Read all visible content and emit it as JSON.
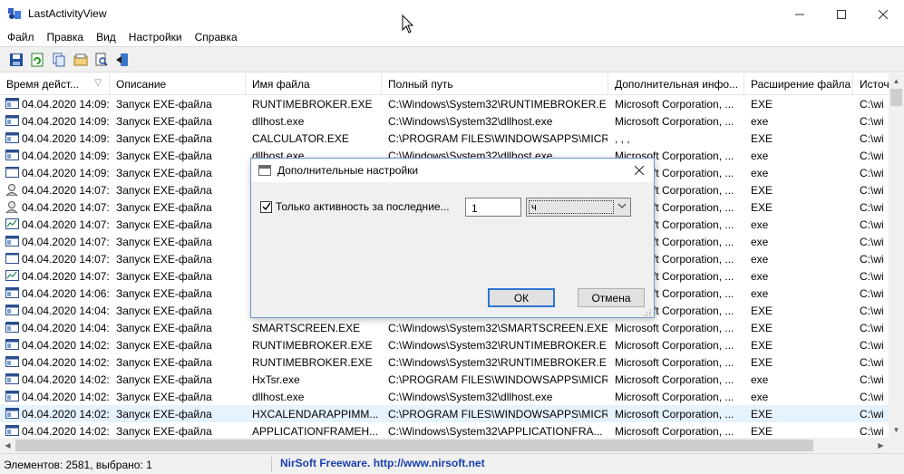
{
  "window": {
    "title": "LastActivityView"
  },
  "menu": [
    "Файл",
    "Правка",
    "Вид",
    "Настройки",
    "Справка"
  ],
  "toolbar": [
    "save-icon",
    "refresh-icon",
    "copy-icon",
    "properties-icon",
    "find-icon",
    "exit-icon"
  ],
  "columns": [
    {
      "label": "Время дейст...",
      "sorted": true
    },
    {
      "label": "Описание"
    },
    {
      "label": "Имя файла"
    },
    {
      "label": "Полный путь"
    },
    {
      "label": "Дополнительная инфо..."
    },
    {
      "label": "Расширение файла"
    },
    {
      "label": "Источ"
    }
  ],
  "rows": [
    {
      "icon": "window",
      "time": "04.04.2020 14:09:...",
      "desc": "Запуск EXE-файла",
      "file": "RUNTIMEBROKER.EXE",
      "path": "C:\\Windows\\System32\\RUNTIMEBROKER.E...",
      "info": "Microsoft Corporation, ...",
      "ext": "EXE",
      "src": "C:\\wi"
    },
    {
      "icon": "window",
      "time": "04.04.2020 14:09:...",
      "desc": "Запуск EXE-файла",
      "file": "dllhost.exe",
      "path": "C:\\Windows\\System32\\dllhost.exe",
      "info": "Microsoft Corporation, ...",
      "ext": "exe",
      "src": "C:\\wi"
    },
    {
      "icon": "window",
      "time": "04.04.2020 14:09:...",
      "desc": "Запуск EXE-файла",
      "file": "CALCULATOR.EXE",
      "path": "C:\\PROGRAM FILES\\WINDOWSAPPS\\MICR...",
      "info": ", , ,",
      "ext": "EXE",
      "src": "C:\\wi"
    },
    {
      "icon": "window",
      "time": "04.04.2020 14:09:...",
      "desc": "Запуск EXE-файла",
      "file": "dllhost.exe",
      "path": "C:\\Windows\\System32\\dllhost.exe",
      "info": "Microsoft Corporation, ...",
      "ext": "exe",
      "src": "C:\\wi"
    },
    {
      "icon": "blank",
      "time": "04.04.2020 14:09:...",
      "desc": "Запуск EXE-файла",
      "file": "",
      "path": "",
      "info": "Microsoft Corporation, ...",
      "ext": "exe",
      "src": "C:\\wi"
    },
    {
      "icon": "user",
      "time": "04.04.2020 14:07:...",
      "desc": "Запуск EXE-файла",
      "file": "",
      "path": "",
      "info": "Microsoft Corporation, ...",
      "ext": "EXE",
      "src": "C:\\wi"
    },
    {
      "icon": "user",
      "time": "04.04.2020 14:07:...",
      "desc": "Запуск EXE-файла",
      "file": "",
      "path": "",
      "info": "Microsoft Corporation, ...",
      "ext": "EXE",
      "src": "C:\\wi"
    },
    {
      "icon": "chart",
      "time": "04.04.2020 14:07:...",
      "desc": "Запуск EXE-файла",
      "file": "",
      "path": "",
      "info": "Microsoft Corporation, ...",
      "ext": "exe",
      "src": "C:\\wi"
    },
    {
      "icon": "window",
      "time": "04.04.2020 14:07:...",
      "desc": "Запуск EXE-файла",
      "file": "",
      "path": "",
      "info": "Microsoft Corporation, ...",
      "ext": "exe",
      "src": "C:\\wi"
    },
    {
      "icon": "blank",
      "time": "04.04.2020 14:07:...",
      "desc": "Запуск EXE-файла",
      "file": "",
      "path": "",
      "info": "Microsoft Corporation, ...",
      "ext": "exe",
      "src": "C:\\wi"
    },
    {
      "icon": "chart",
      "time": "04.04.2020 14:07:...",
      "desc": "Запуск EXE-файла",
      "file": "",
      "path": "",
      "info": "Microsoft Corporation, ...",
      "ext": "exe",
      "src": "C:\\wi"
    },
    {
      "icon": "window",
      "time": "04.04.2020 14:06:...",
      "desc": "Запуск EXE-файла",
      "file": "",
      "path": "",
      "info": "Microsoft Corporation, ...",
      "ext": "exe",
      "src": "C:\\wi"
    },
    {
      "icon": "window",
      "time": "04.04.2020 14:04:...",
      "desc": "Запуск EXE-файла",
      "file": "",
      "path": "",
      "info": "Microsoft Corporation, ...",
      "ext": "EXE",
      "src": "C:\\wi"
    },
    {
      "icon": "window",
      "time": "04.04.2020 14:04:...",
      "desc": "Запуск EXE-файла",
      "file": "SMARTSCREEN.EXE",
      "path": "C:\\Windows\\System32\\SMARTSCREEN.EXE",
      "info": "Microsoft Corporation, ...",
      "ext": "EXE",
      "src": "C:\\wi"
    },
    {
      "icon": "window",
      "time": "04.04.2020 14:02:...",
      "desc": "Запуск EXE-файла",
      "file": "RUNTIMEBROKER.EXE",
      "path": "C:\\Windows\\System32\\RUNTIMEBROKER.E...",
      "info": "Microsoft Corporation, ...",
      "ext": "EXE",
      "src": "C:\\wi"
    },
    {
      "icon": "window",
      "time": "04.04.2020 14:02:...",
      "desc": "Запуск EXE-файла",
      "file": "RUNTIMEBROKER.EXE",
      "path": "C:\\Windows\\System32\\RUNTIMEBROKER.E...",
      "info": "Microsoft Corporation, ...",
      "ext": "EXE",
      "src": "C:\\wi"
    },
    {
      "icon": "window",
      "time": "04.04.2020 14:02:...",
      "desc": "Запуск EXE-файла",
      "file": "HxTsr.exe",
      "path": "C:\\PROGRAM FILES\\WINDOWSAPPS\\MICR...",
      "info": "Microsoft Corporation, ...",
      "ext": "exe",
      "src": "C:\\wi"
    },
    {
      "icon": "window",
      "time": "04.04.2020 14:02:...",
      "desc": "Запуск EXE-файла",
      "file": "dllhost.exe",
      "path": "C:\\Windows\\System32\\dllhost.exe",
      "info": "Microsoft Corporation, ...",
      "ext": "exe",
      "src": "C:\\wi"
    },
    {
      "icon": "window",
      "time": "04.04.2020 14:02:...",
      "desc": "Запуск EXE-файла",
      "file": "HXCALENDARAPPIMM...",
      "path": "C:\\PROGRAM FILES\\WINDOWSAPPS\\MICR...",
      "info": "Microsoft Corporation, ...",
      "ext": "EXE",
      "src": "C:\\wi",
      "selected": true
    },
    {
      "icon": "window",
      "time": "04.04.2020 14:02:...",
      "desc": "Запуск EXE-файла",
      "file": "APPLICATIONFRAMEH...",
      "path": "C:\\Windows\\System32\\APPLICATIONFRA...",
      "info": "Microsoft Corporation, ...",
      "ext": "EXE",
      "src": "C:\\wi"
    }
  ],
  "status": {
    "count": "Элементов: 2581, выбрано: 1",
    "brand": "NirSoft Freeware.  http://www.nirsoft.net"
  },
  "dialog": {
    "title": "Дополнительные настройки",
    "checkbox_label": "Только активность за последние...",
    "checked": true,
    "number_value": "1",
    "unit_value": "ч",
    "ok_label": "ОК",
    "cancel_label": "Отмена"
  }
}
